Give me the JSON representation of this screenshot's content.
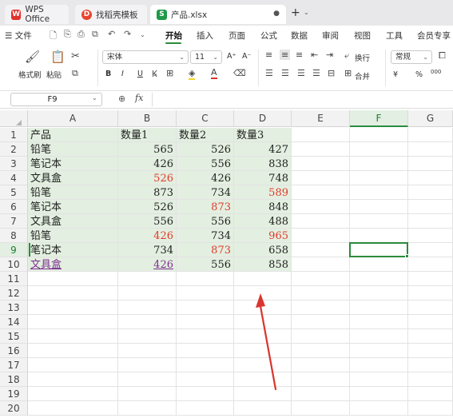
{
  "tabs": {
    "wps": "WPS Office",
    "template": "找稻壳模板",
    "file": "产品.xlsx",
    "new_tab": "+",
    "new_tab_dropdown": "⌄"
  },
  "menu": {
    "file": "☰ 文件",
    "items": [
      "开始",
      "插入",
      "页面",
      "公式",
      "数据",
      "审阅",
      "视图",
      "工具",
      "会员专享"
    ],
    "active": "开始"
  },
  "ribbon": {
    "format_painter": "格式刷",
    "paste": "粘贴",
    "font_name": "宋体",
    "font_size": "11",
    "wrap": "换行",
    "merge": "合并",
    "number_format": "常规",
    "percent": "%",
    "thousands": "000",
    "currency": "¥",
    "bold": "B",
    "italic": "I",
    "underline": "U",
    "grow": "A⁺",
    "shrink": "A⁻"
  },
  "formula_bar": {
    "cell_ref": "F9",
    "fx": "fx",
    "formula": ""
  },
  "grid": {
    "columns": [
      "A",
      "B",
      "C",
      "D",
      "E",
      "F",
      "G"
    ],
    "rows": [
      "1",
      "2",
      "3",
      "4",
      "5",
      "6",
      "7",
      "8",
      "9",
      "10",
      "11",
      "12",
      "13",
      "14",
      "15",
      "16",
      "17",
      "18",
      "19",
      "20"
    ],
    "selected_column": "F",
    "selected_row": "9",
    "header": [
      "产品",
      "数量1",
      "数量2",
      "数量3"
    ],
    "data": [
      [
        "铅笔",
        "565",
        "526",
        "427"
      ],
      [
        "笔记本",
        "426",
        "556",
        "838"
      ],
      [
        "文具盒",
        "526",
        "426",
        "748"
      ],
      [
        "铅笔",
        "873",
        "734",
        "589"
      ],
      [
        "笔记本",
        "526",
        "873",
        "848"
      ],
      [
        "文具盒",
        "556",
        "556",
        "488"
      ],
      [
        "铅笔",
        "426",
        "734",
        "965"
      ],
      [
        "笔记本",
        "734",
        "873",
        "658"
      ],
      [
        "文具盒",
        "426",
        "556",
        "858"
      ]
    ],
    "red_cells": [
      "3-1",
      "4-3",
      "5-2",
      "7-1",
      "7-3",
      "8-2"
    ],
    "purple_cells": [
      "9-0",
      "9-1"
    ]
  },
  "colors": {
    "accent": "#2a8c3f",
    "data_fill": "#e3efe0",
    "red_text": "#e03a2d",
    "annotation_arrow": "#d9362f"
  },
  "icons": [
    "wps-logo-icon",
    "template-icon",
    "sheet-icon",
    "save-icon",
    "print-icon",
    "undo-icon",
    "redo-icon",
    "zoom-icon",
    "fx-icon"
  ]
}
